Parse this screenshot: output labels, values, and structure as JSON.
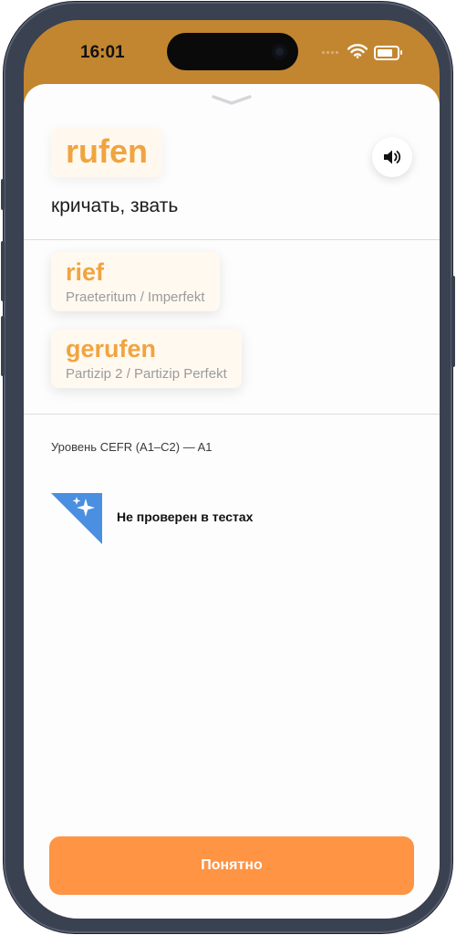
{
  "status_bar": {
    "time": "16:01"
  },
  "word": {
    "text": "rufen",
    "translation": "кричать, звать"
  },
  "forms": [
    {
      "word": "rief",
      "label": "Praeteritum / Imperfekt"
    },
    {
      "word": "gerufen",
      "label": "Partizip 2 / Partizip Perfekt"
    }
  ],
  "cefr": {
    "text": "Уровень CEFR (A1–C2) —  A1"
  },
  "test_status": {
    "text": "Не проверен в тестах",
    "icon": "sparkles-icon"
  },
  "button": {
    "label": "Понятно"
  },
  "colors": {
    "accent": "#f0a440",
    "button": "#fe9444",
    "header": "#c28631",
    "badge": "#4a8fe0"
  }
}
